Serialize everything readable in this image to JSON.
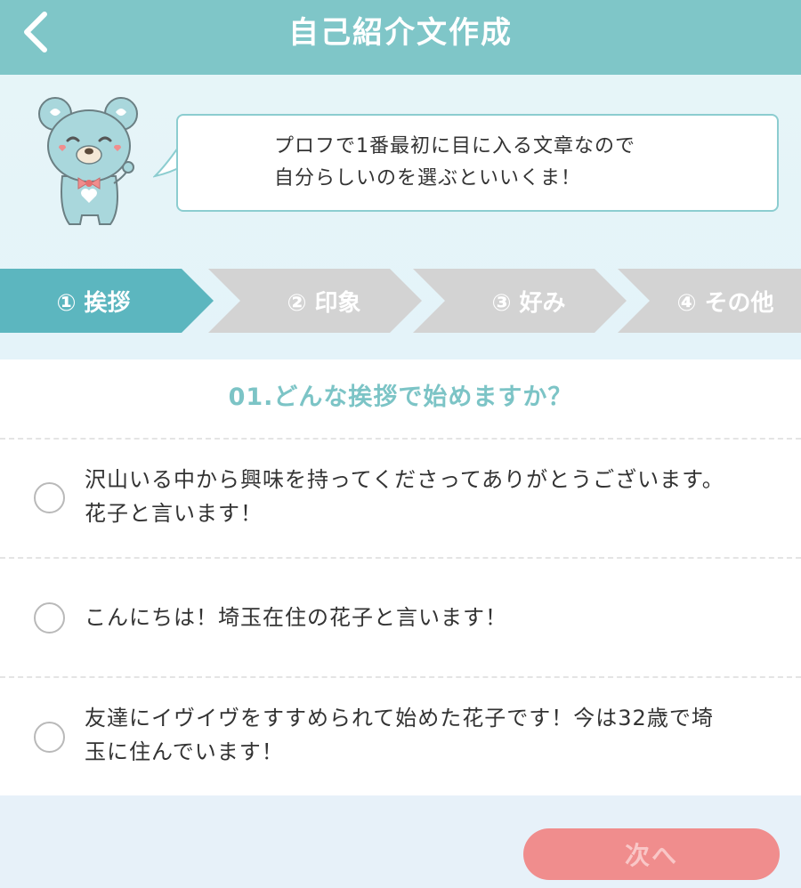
{
  "header": {
    "title": "自己紹介文作成",
    "back_icon": "chevron-left-icon"
  },
  "intro": {
    "mascot": "bear-mascot",
    "message_line1": "プロフで1番最初に目に入る文章なので",
    "message_line2": "自分らしいのを選ぶといいくま！"
  },
  "steps": [
    {
      "label": "① 挨拶",
      "active": true
    },
    {
      "label": "② 印象",
      "active": false
    },
    {
      "label": "③ 好み",
      "active": false
    },
    {
      "label": "④ その他",
      "active": false
    }
  ],
  "question": {
    "text": "01.どんな挨拶で始めますか？",
    "options": [
      {
        "line1": "沢山いる中から興味を持ってくださってありがとうございます。",
        "line2": "花子と言います！",
        "selected": false
      },
      {
        "line1": "こんにちは！埼玉在住の花子と言います！",
        "line2": "",
        "selected": false
      },
      {
        "line1": "友達にイヴイヴをすすめられて始めた花子です！今は32歳で埼",
        "line2": "玉に住んでいます！",
        "selected": false
      }
    ]
  },
  "footer": {
    "next_label": "次へ"
  },
  "colors": {
    "header": "#7fc6c8",
    "step_active": "#5cb6bf",
    "step_inactive": "#d3d3d3",
    "question": "#7cc4c6",
    "next_button": "#f08d8d"
  }
}
